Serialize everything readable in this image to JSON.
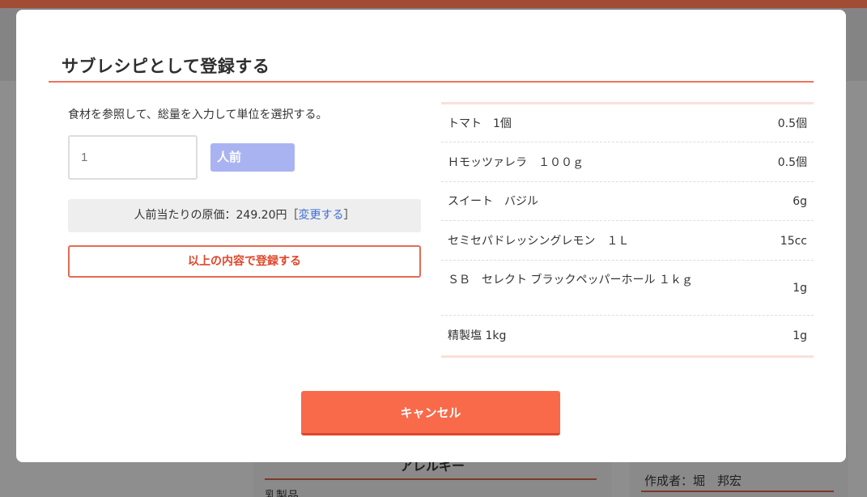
{
  "background": {
    "card_left_title": "アレルギー",
    "card_left_sub": "乳製品",
    "card_right_text": "作成者：堀　邦宏"
  },
  "modal": {
    "title": "サブレシピとして登録する",
    "instruction": "食材を参照して、総量を入力して単位を選択する。",
    "quantity_placeholder": "1",
    "unit_label": "人前",
    "cost_text": "人前当たりの原価：249.20円［",
    "cost_link": "変更する",
    "cost_close": "］",
    "register_label": "以上の内容で登録する",
    "cancel_label": "キャンセル"
  },
  "ingredients": [
    {
      "name": "トマト　1個",
      "amount": "0.5個"
    },
    {
      "name": "Ｈモッツァレラ　１００ｇ",
      "amount": "0.5個"
    },
    {
      "name": "スイート　バジル",
      "amount": "6g"
    },
    {
      "name": "セミセパドレッシングレモン　１Ｌ",
      "amount": "15cc"
    },
    {
      "name": "ＳＢ　セレクト ブラックペッパーホール １ｋｇ",
      "amount": "1g"
    },
    {
      "name": "精製塩 1kg",
      "amount": "1g"
    }
  ],
  "colors": {
    "accent": "#f86a4a",
    "unit_button": "#aab3f2",
    "link": "#3c6ed6"
  }
}
